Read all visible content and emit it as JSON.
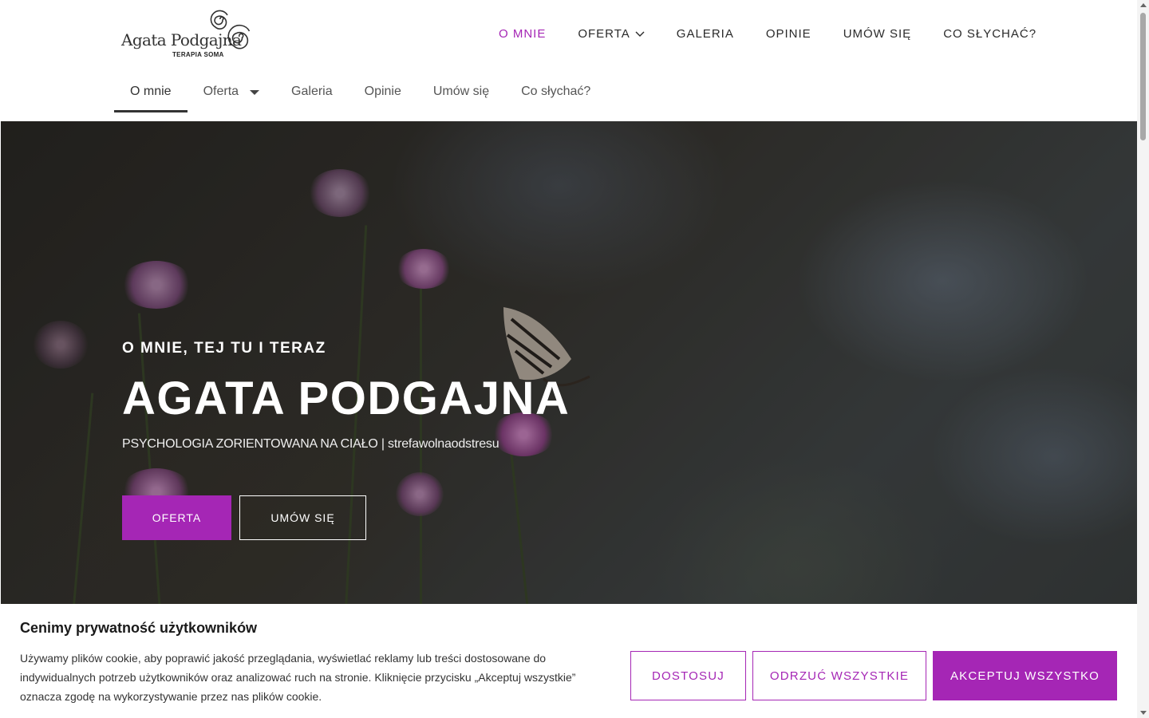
{
  "logo": {
    "name": "Agata Podgajna",
    "subtitle": "TERAPIA SOMA"
  },
  "main_nav": [
    {
      "label": "O MNIE",
      "active": true
    },
    {
      "label": "OFERTA",
      "has_dropdown": true
    },
    {
      "label": "GALERIA"
    },
    {
      "label": "OPINIE"
    },
    {
      "label": "UMÓW SIĘ"
    },
    {
      "label": "CO SŁYCHAĆ?"
    }
  ],
  "sub_nav": [
    {
      "label": "O mnie",
      "active": true
    },
    {
      "label": "Oferta",
      "has_dropdown": true
    },
    {
      "label": "Galeria"
    },
    {
      "label": "Opinie"
    },
    {
      "label": "Umów się"
    },
    {
      "label": "Co słychać?"
    }
  ],
  "hero": {
    "kicker": "O MNIE, TEJ TU I TERAZ",
    "title": "AGATA PODGAJNA",
    "subtitle": "PSYCHOLOGIA ZORIENTOWANA NA CIAŁO | strefawolnaodstresu",
    "button_primary": "OFERTA",
    "button_secondary": "UMÓW SIĘ"
  },
  "cookie": {
    "title": "Cenimy prywatność użytkowników",
    "text": "Używamy plików cookie, aby poprawić jakość przeglądania, wyświetlać reklamy lub treści dostosowane do indywidualnych potrzeb użytkowników oraz analizować ruch na stronie. Kliknięcie przycisku „Akceptuj wszystkie” oznacza zgodę na wykorzystywanie przez nas plików cookie.",
    "customize": "DOSTOSUJ",
    "reject": "ODRZUĆ WSZYSTKIE",
    "accept": "AKCEPTUJ WSZYSTKO"
  },
  "colors": {
    "accent": "#a526b5",
    "text": "#2a2a2a"
  }
}
